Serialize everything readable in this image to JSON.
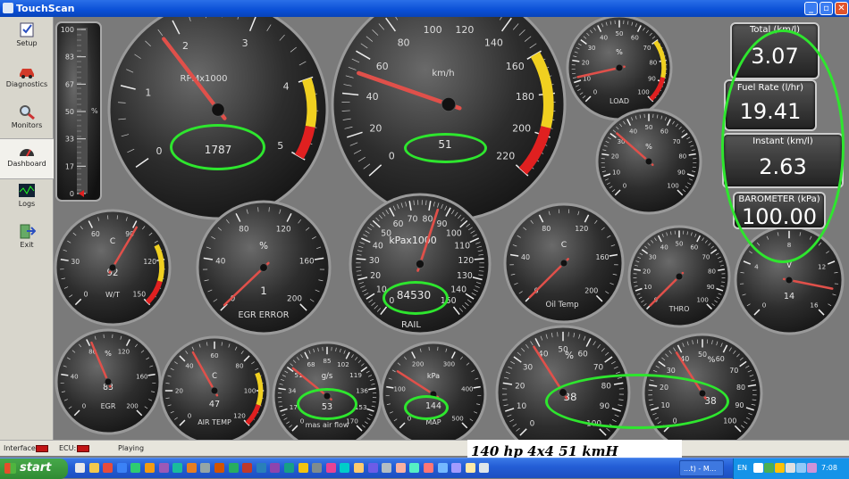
{
  "window": {
    "title": "TouchScan",
    "controls": [
      "_",
      "▫",
      "✕"
    ]
  },
  "sidebar": {
    "items": [
      {
        "label": "Setup",
        "icon": "checklist-icon"
      },
      {
        "label": "Diagnostics",
        "icon": "car-icon"
      },
      {
        "label": "Monitors",
        "icon": "magnifier-icon"
      },
      {
        "label": "Dashboard",
        "icon": "gauge-icon"
      },
      {
        "label": "Logs",
        "icon": "graph-icon"
      },
      {
        "label": "Exit",
        "icon": "exit-icon"
      }
    ]
  },
  "bar_gauge": {
    "ticks": [
      "100",
      "83",
      "67",
      "50",
      "33",
      "17",
      "0"
    ],
    "unit": "%",
    "level": 0
  },
  "gauges": [
    {
      "id": "rpm",
      "label": "RPMx1000",
      "ticks": [
        "0",
        "1",
        "2",
        "3",
        "4",
        "5"
      ],
      "min": 0,
      "max": 5,
      "value": 1.787,
      "readout": "1787",
      "red_from": 4
    },
    {
      "id": "speed",
      "label": "km/h",
      "ticks": [
        "0",
        "20",
        "40",
        "60",
        "80",
        "100",
        "120",
        "140",
        "160",
        "180",
        "200",
        "220"
      ],
      "min": 0,
      "max": 220,
      "value": 51,
      "readout": "51",
      "red_from": 160
    },
    {
      "id": "load",
      "label": "LOAD",
      "unit": "%",
      "ticks": [
        "0",
        "10",
        "20",
        "30",
        "40",
        "50",
        "60",
        "70",
        "80",
        "90",
        "100"
      ],
      "min": 0,
      "max": 100,
      "value": 12,
      "readout": "",
      "red_from": 70
    },
    {
      "id": "pct2",
      "label": "",
      "unit": "%",
      "ticks": [
        "0",
        "10",
        "20",
        "30",
        "40",
        "50",
        "60",
        "70",
        "80",
        "90",
        "100"
      ],
      "min": 0,
      "max": 100,
      "value": 32,
      "readout": "",
      "red_from": null
    },
    {
      "id": "wt",
      "label": "W/T",
      "unit": "C",
      "ticks": [
        "0",
        "30",
        "60",
        "90",
        "120",
        "150"
      ],
      "min": 0,
      "max": 150,
      "value": 92,
      "readout": "92",
      "red_from": 110
    },
    {
      "id": "egr_error",
      "label": "EGR ERROR",
      "unit": "%",
      "ticks": [
        "0",
        "40",
        "80",
        "120",
        "160",
        "200"
      ],
      "min": 0,
      "max": 200,
      "value": 1,
      "readout": "1",
      "red_from": null
    },
    {
      "id": "rail",
      "label": "RAIL",
      "unit": "kPax1000",
      "ticks": [
        "0",
        "10",
        "20",
        "30",
        "40",
        "50",
        "60",
        "70",
        "80",
        "90",
        "100",
        "110",
        "120",
        "130",
        "140",
        "150"
      ],
      "min": 0,
      "max": 150,
      "value": 84.53,
      "readout": "84530",
      "red_from": null
    },
    {
      "id": "oil",
      "label": "Oil Temp",
      "unit": "C",
      "ticks": [
        "0",
        "40",
        "80",
        "120",
        "160",
        "200"
      ],
      "min": 0,
      "max": 200,
      "value": 0,
      "readout": "",
      "red_from": null
    },
    {
      "id": "thro",
      "label": "THRO",
      "unit": "",
      "ticks": [
        "0",
        "10",
        "20",
        "30",
        "40",
        "50",
        "60",
        "70",
        "80",
        "90",
        "100"
      ],
      "min": 0,
      "max": 100,
      "value": 0,
      "readout": "",
      "red_from": null
    },
    {
      "id": "volt",
      "label": "",
      "unit": "V",
      "ticks": [
        "0",
        "4",
        "8",
        "12",
        "16"
      ],
      "min": 0,
      "max": 16,
      "value": 14,
      "readout": "14",
      "red_from": null
    },
    {
      "id": "egr",
      "label": "EGR",
      "unit": "%",
      "ticks": [
        "0",
        "40",
        "80",
        "120",
        "160",
        "200"
      ],
      "min": 0,
      "max": 200,
      "value": 83,
      "readout": "83",
      "red_from": null
    },
    {
      "id": "air_temp",
      "label": "AIR TEMP",
      "unit": "C",
      "ticks": [
        "0",
        "20",
        "40",
        "60",
        "80",
        "100",
        "120"
      ],
      "min": 0,
      "max": 120,
      "value": 47,
      "readout": "47",
      "red_from": 90
    },
    {
      "id": "maf",
      "label": "mas air flow",
      "unit": "g/s",
      "ticks": [
        "0",
        "17",
        "34",
        "51",
        "68",
        "85",
        "102",
        "119",
        "136",
        "153",
        "170"
      ],
      "min": 0,
      "max": 170,
      "value": 53,
      "readout": "53",
      "red_from": null
    },
    {
      "id": "map",
      "label": "MAP",
      "unit": "kPa",
      "ticks": [
        "0",
        "100",
        "200",
        "300",
        "400",
        "500"
      ],
      "min": 0,
      "max": 500,
      "value": 144,
      "readout": "144",
      "red_from": null
    },
    {
      "id": "bl",
      "label": "",
      "unit": "%",
      "ticks": [
        "0",
        "10",
        "20",
        "30",
        "40",
        "50",
        "60",
        "70",
        "80",
        "90",
        "100"
      ],
      "min": 0,
      "max": 100,
      "value": 38,
      "readout": "38",
      "red_from": null
    },
    {
      "id": "br",
      "label": "",
      "unit": "%",
      "ticks": [
        "0",
        "10",
        "20",
        "30",
        "40",
        "50",
        "60",
        "70",
        "80",
        "90",
        "100"
      ],
      "min": 0,
      "max": 100,
      "value": 38,
      "readout": "38",
      "red_from": null
    }
  ],
  "digital": [
    {
      "label": "Total (km/l)",
      "value": "3.07"
    },
    {
      "label": "Fuel Rate (l/hr)",
      "value": "19.41"
    },
    {
      "label": "Instant (km/l)",
      "value": "2.63"
    },
    {
      "label": "BAROMETER (kPa)",
      "value": "100.00"
    }
  ],
  "status": {
    "interface_label": "Interface:",
    "ecu_label": "ECU:",
    "state": "Playing"
  },
  "caption": "140 hp 4x4 51 kmH",
  "taskbar": {
    "start": "start",
    "task_item": "...t) - M...",
    "lang": "EN",
    "clock": "7:08"
  },
  "colors": {
    "highlight": "#2ee62e",
    "needle": "#e0504a",
    "redzone": "#e02020",
    "yellowzone": "#f0d020"
  }
}
